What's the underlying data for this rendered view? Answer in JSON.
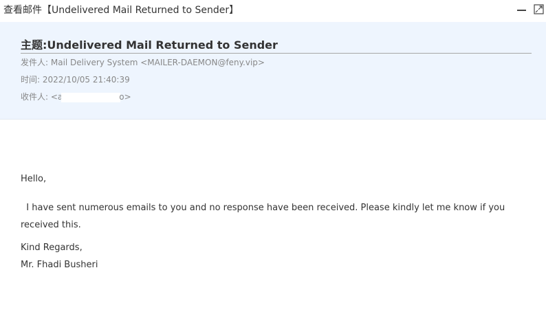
{
  "window": {
    "title": "查看邮件【Undelivered Mail Returned to Sender】",
    "minimize_icon": "minimize-icon",
    "maximize_icon": "maximize-icon"
  },
  "header": {
    "subject_label": "主题:",
    "subject": "Undelivered Mail Returned to Sender",
    "from_label": "发件人: ",
    "from_value": "Mail Delivery System <MAILER-DAEMON@feny.vip>",
    "time_label": "时间: ",
    "time_value": "2022/10/05 21:40:39",
    "to_label": "收件人: ",
    "to_prefix": "<a",
    "to_suffix": "o>"
  },
  "body": {
    "greeting": "Hello,",
    "paragraph": "  I have sent numerous emails to you and no response have been received. Please kindly let me know if you received this.",
    "closing": "Kind Regards,",
    "signer": "Mr. Fhadi Busheri"
  },
  "colors": {
    "header_bg": "#eef5fe",
    "text": "#333333",
    "meta_text": "#888888"
  }
}
